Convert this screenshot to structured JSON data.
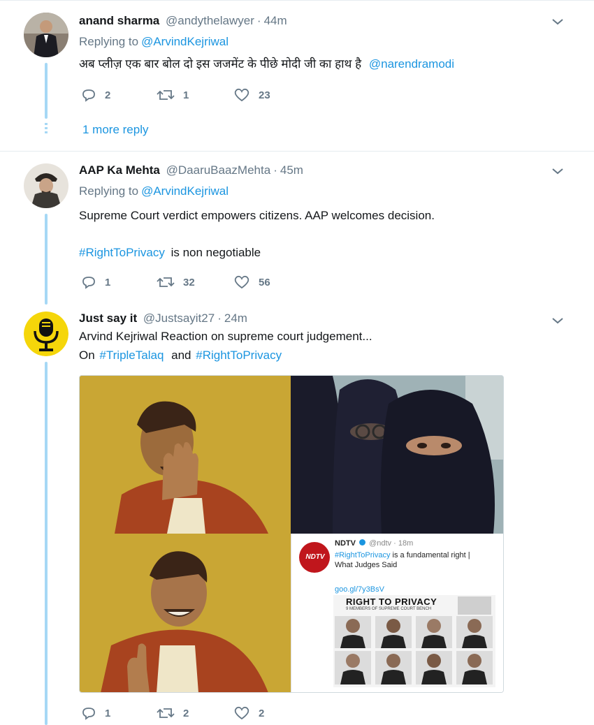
{
  "tweets": [
    {
      "name": "anand sharma",
      "handle": "@andythelawyer",
      "time": "44m",
      "replying_label": "Replying to",
      "replying_to": "@ArvindKejriwal",
      "text": "अब प्लीज़ एक बार बोल दो इस जजमेंट के पीछे मोदी जी का हाथ है",
      "text_mention": "@narendramodi",
      "replies": "2",
      "retweets": "1",
      "likes": "23",
      "more_replies": "1 more reply"
    },
    {
      "name": "AAP Ka Mehta",
      "handle": "@DaaruBaazMehta",
      "time": "45m",
      "replying_label": "Replying to",
      "replying_to": "@ArvindKejriwal",
      "text_line1": "Supreme Court verdict empowers citizens. AAP welcomes decision.",
      "hashtag": "#RightToPrivacy",
      "text_line2_rest": "is non negotiable",
      "replies": "1",
      "retweets": "32",
      "likes": "56"
    },
    {
      "name": "Just say it",
      "handle": "@Justsayit27",
      "time": "24m",
      "text_line1": "Arvind Kejriwal Reaction on supreme court judgement...",
      "line2_prefix": "On",
      "hashtag1": "#TripleTalaq",
      "line2_mid": "and",
      "hashtag2": "#RightToPrivacy",
      "replies": "1",
      "retweets": "2",
      "likes": "2"
    }
  ],
  "media": {
    "embed_source": "NDTV",
    "embed_handle": "@ndtv",
    "embed_time": "18m",
    "embed_hashtag": "#RightToPrivacy",
    "embed_text": "is a fundamental right |",
    "embed_text2": "What Judges Said",
    "embed_link": "goo.gl/7y3BsV",
    "embed_title": "RIGHT TO PRIVACY",
    "embed_subtitle": "9 MEMBERS OF SUPREME COURT BENCH"
  },
  "colors": {
    "accent": "#1b95e0",
    "muted": "#657786",
    "thread": "#a6d8f5",
    "meme_yellow": "#c9a634",
    "ndtv_red": "#c0161c"
  }
}
